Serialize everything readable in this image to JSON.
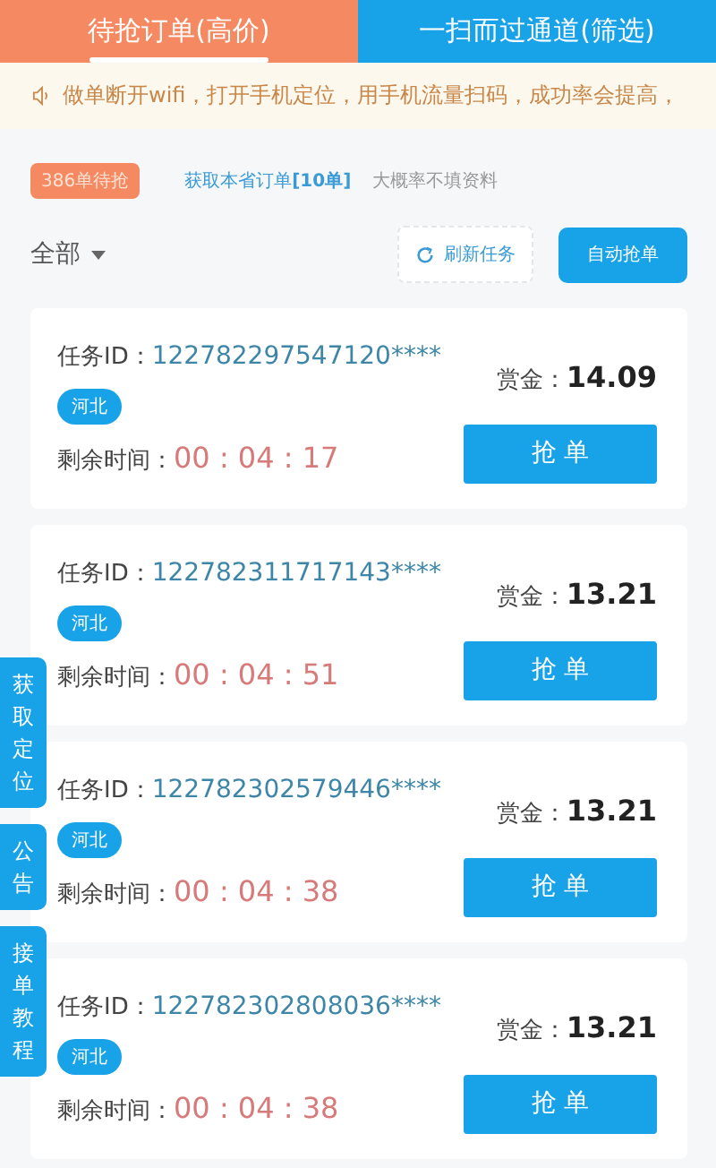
{
  "tabs": [
    {
      "label": "待抢订单(高价)",
      "selected": true
    },
    {
      "label": "一扫而过通道(筛选)",
      "selected": false
    }
  ],
  "notice": "做单断开wifi，打开手机定位，用手机流量扫码，成功率会提高，",
  "stats": {
    "badge": "386单待抢",
    "link": "获取本省订单**[10单]**",
    "hint": "大概率不填资料"
  },
  "toolbar": {
    "filter": "全部",
    "refresh": "刷新任务",
    "auto": "自动抢单"
  },
  "orders": [
    {
      "id_label": "任务ID：",
      "id": "122782297547120****",
      "region": "河北",
      "bounty_label": "赏金：",
      "bounty": "14.09",
      "time_label": "剩余时间：",
      "time": "00 : 04 : 17",
      "button": "抢 单"
    },
    {
      "id_label": "任务ID：",
      "id": "122782311717143****",
      "region": "河北",
      "bounty_label": "赏金：",
      "bounty": "13.21",
      "time_label": "剩余时间：",
      "time": "00 : 04 : 51",
      "button": "抢 单"
    },
    {
      "id_label": "任务ID：",
      "id": "122782302579446****",
      "region": "河北",
      "bounty_label": "赏金：",
      "bounty": "13.21",
      "time_label": "剩余时间：",
      "time": "00 : 04 : 38",
      "button": "抢 单"
    },
    {
      "id_label": "任务ID：",
      "id": "122782302808036****",
      "region": "河北",
      "bounty_label": "赏金：",
      "bounty": "13.21",
      "time_label": "剩余时间：",
      "time": "00 : 04 : 38",
      "button": "抢 单"
    }
  ],
  "side_tabs": [
    "获取定位",
    "公告",
    "接单教程"
  ]
}
